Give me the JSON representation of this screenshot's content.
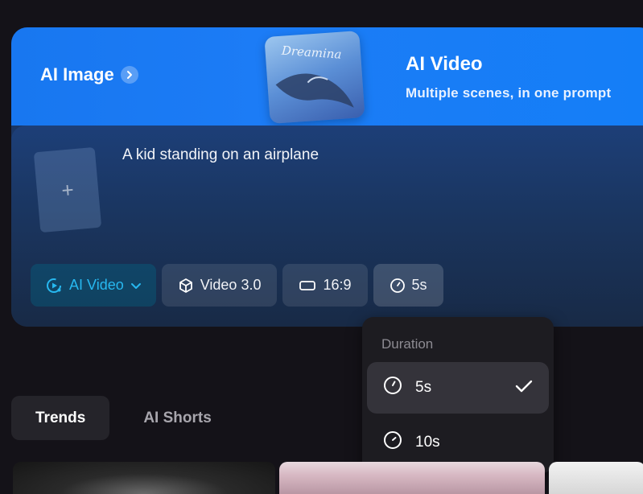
{
  "banner": {
    "ai_image_label": "AI Image",
    "thumbnail_script": "Dreamina",
    "ai_video_title": "AI Video",
    "ai_video_subtitle": "Multiple scenes, in one prompt"
  },
  "prompt": {
    "text": "A kid standing on an airplane",
    "upload_symbol": "+"
  },
  "toolbar": {
    "mode_label": "AI Video",
    "model_label": "Video 3.0",
    "ratio_label": "16:9",
    "duration_label": "5s"
  },
  "duration_popup": {
    "header": "Duration",
    "options": [
      {
        "label": "5s",
        "selected": true
      },
      {
        "label": "10s",
        "selected": false
      }
    ]
  },
  "tabs": [
    {
      "label": "Trends",
      "active": true
    },
    {
      "label": "AI Shorts",
      "active": false
    }
  ],
  "icons": {
    "ai_image_chevron": "chevron-right-icon",
    "mode": "video-sparkle-icon",
    "mode_dropdown": "chevron-down-icon",
    "model": "cube-icon",
    "ratio": "aspect-ratio-icon",
    "duration": "clock-icon",
    "selected": "check-icon"
  },
  "colors": {
    "accent": "#27b8f0",
    "banner_blue": "#1877f0",
    "page_bg": "#141218"
  }
}
